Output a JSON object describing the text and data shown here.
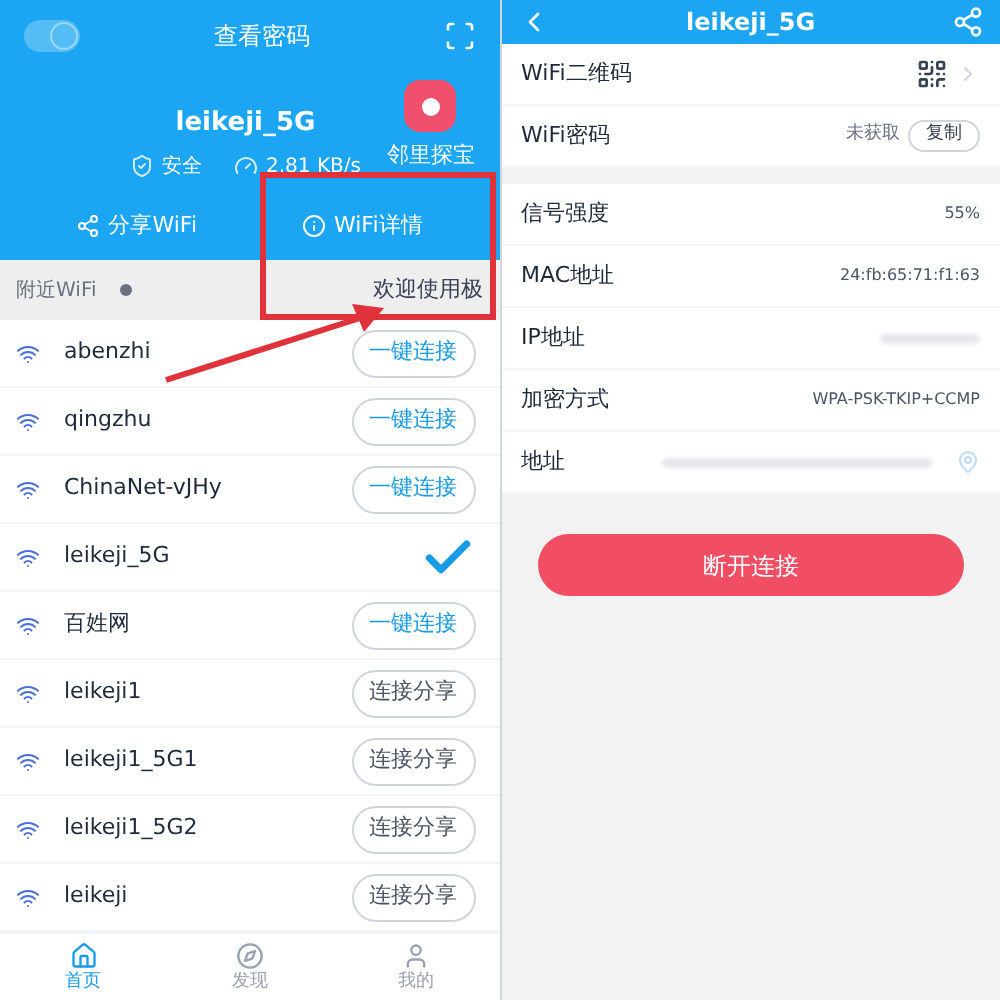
{
  "left": {
    "toggle_on": true,
    "title": "查看密码",
    "network": "leikeji_5G",
    "security": "安全",
    "speed": "2.81 KB/s",
    "badge": "邻里探宝",
    "actions": [
      {
        "label": "分享WiFi",
        "kind": "share"
      },
      {
        "label": "WiFi详情",
        "kind": "info"
      }
    ],
    "nearby": {
      "label": "附近WiFi",
      "notice": "欢迎使用极"
    },
    "networks": [
      {
        "name": "abenzhi",
        "kind": "connect",
        "action": "一键连接"
      },
      {
        "name": "qingzhu",
        "kind": "connect",
        "action": "一键连接"
      },
      {
        "name": "ChinaNet-vJHy",
        "kind": "connect",
        "action": "一键连接"
      },
      {
        "name": "leikeji_5G",
        "kind": "connected"
      },
      {
        "name": "百姓网",
        "kind": "connect",
        "action": "一键连接"
      },
      {
        "name": "leikeji1",
        "kind": "share",
        "action": "连接分享"
      },
      {
        "name": "leikeji1_5G1",
        "kind": "share",
        "action": "连接分享"
      },
      {
        "name": "leikeji1_5G2",
        "kind": "share",
        "action": "连接分享"
      },
      {
        "name": "leikeji",
        "kind": "share",
        "action": "连接分享"
      }
    ],
    "tabs": [
      {
        "label": "首页",
        "selected": true
      },
      {
        "label": "发现",
        "selected": false
      },
      {
        "label": "我的",
        "selected": false
      }
    ]
  },
  "right": {
    "title": "leikeji_5G",
    "groups": [
      [
        {
          "label": "WiFi二维码",
          "kind": "qr"
        },
        {
          "label": "WiFi密码",
          "kind": "password",
          "value": "未获取",
          "action": "复制"
        }
      ],
      [
        {
          "label": "信号强度",
          "kind": "text",
          "value": "55%"
        },
        {
          "label": "MAC地址",
          "kind": "text",
          "value": "24:fb:65:71:f1:63"
        },
        {
          "label": "IP地址",
          "kind": "hidden"
        },
        {
          "label": "加密方式",
          "kind": "text",
          "value": "WPA-PSK-TKIP+CCMP"
        },
        {
          "label": "地址",
          "kind": "location"
        }
      ]
    ],
    "disconnect": "断开连接"
  }
}
